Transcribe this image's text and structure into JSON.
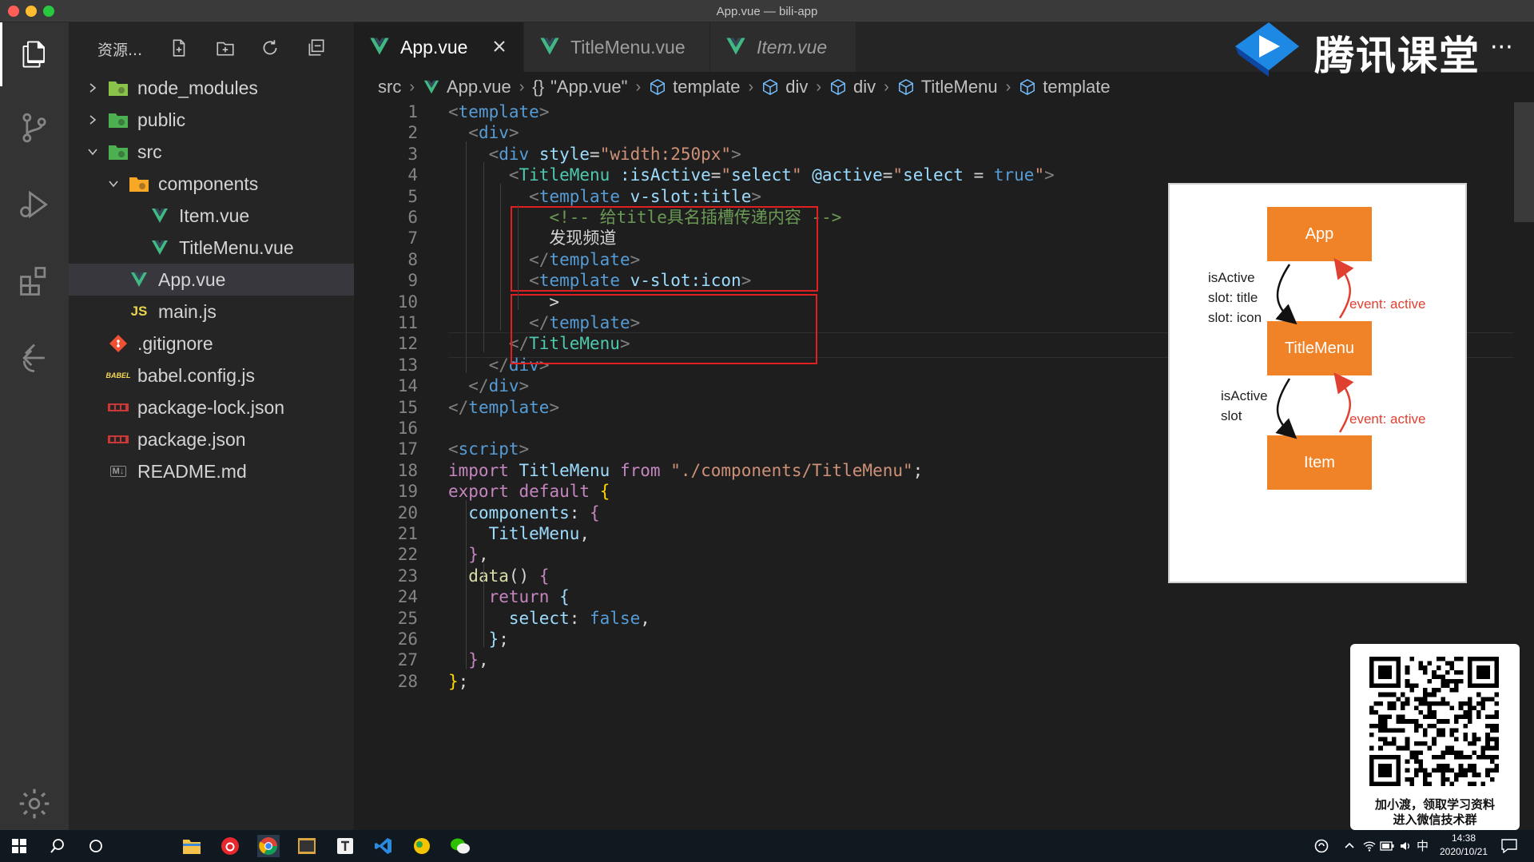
{
  "window": {
    "title": "App.vue — bili-app"
  },
  "sidebar": {
    "title": "资源...",
    "tree": [
      {
        "name": "node_modules",
        "kind": "folder",
        "expanded": false,
        "depth": 0,
        "icon": "folder-node-icon"
      },
      {
        "name": "public",
        "kind": "folder",
        "expanded": false,
        "depth": 0,
        "icon": "folder-public-icon"
      },
      {
        "name": "src",
        "kind": "folder",
        "expanded": true,
        "depth": 0,
        "icon": "folder-src-icon"
      },
      {
        "name": "components",
        "kind": "folder",
        "expanded": true,
        "depth": 1,
        "icon": "folder-components-icon"
      },
      {
        "name": "Item.vue",
        "kind": "vue",
        "depth": 2,
        "icon": "vue-file-icon"
      },
      {
        "name": "TitleMenu.vue",
        "kind": "vue",
        "depth": 2,
        "icon": "vue-file-icon"
      },
      {
        "name": "App.vue",
        "kind": "vue",
        "depth": 1,
        "icon": "vue-file-icon",
        "selected": true
      },
      {
        "name": "main.js",
        "kind": "js",
        "depth": 1,
        "icon": "js-file-icon"
      },
      {
        "name": ".gitignore",
        "kind": "git",
        "depth": 0,
        "icon": "git-file-icon"
      },
      {
        "name": "babel.config.js",
        "kind": "babel",
        "depth": 0,
        "icon": "babel-file-icon"
      },
      {
        "name": "package-lock.json",
        "kind": "npm",
        "depth": 0,
        "icon": "npm-file-icon"
      },
      {
        "name": "package.json",
        "kind": "npm",
        "depth": 0,
        "icon": "npm-file-icon"
      },
      {
        "name": "README.md",
        "kind": "md",
        "depth": 0,
        "icon": "markdown-file-icon"
      }
    ],
    "js_badge": "JS",
    "md_badge": "M↓",
    "babel_badge": "BABEL"
  },
  "tabs": [
    {
      "label": "App.vue",
      "active": true
    },
    {
      "label": "TitleMenu.vue",
      "active": false
    },
    {
      "label": "Item.vue",
      "active": false,
      "italic": true
    }
  ],
  "breadcrumb": [
    "src",
    "App.vue",
    "\"App.vue\"",
    "template",
    "div",
    "div",
    "TitleMenu",
    "template"
  ],
  "breadcrumb_braces": "{}",
  "editor": {
    "line_numbers": [
      "1",
      "2",
      "3",
      "4",
      "5",
      "6",
      "7",
      "8",
      "9",
      "10",
      "11",
      "12",
      "13",
      "14",
      "15",
      "16",
      "17",
      "18",
      "19",
      "20",
      "21",
      "22",
      "23",
      "24",
      "25",
      "26",
      "27",
      "28"
    ],
    "lines": [
      [
        [
          "tk-br",
          "<"
        ],
        [
          "tk-tag",
          "template"
        ],
        [
          "tk-br",
          ">"
        ]
      ],
      [
        [
          "tk-plain",
          "  "
        ],
        [
          "tk-br",
          "<"
        ],
        [
          "tk-tag",
          "div"
        ],
        [
          "tk-br",
          ">"
        ]
      ],
      [
        [
          "tk-plain",
          "    "
        ],
        [
          "tk-br",
          "<"
        ],
        [
          "tk-tag",
          "div"
        ],
        [
          "tk-plain",
          " "
        ],
        [
          "tk-attr",
          "style"
        ],
        [
          "tk-plain",
          "="
        ],
        [
          "tk-str",
          "\"width:250px\""
        ],
        [
          "tk-br",
          ">"
        ]
      ],
      [
        [
          "tk-plain",
          "      "
        ],
        [
          "tk-br",
          "<"
        ],
        [
          "tk-comp",
          "TitleMenu"
        ],
        [
          "tk-plain",
          " "
        ],
        [
          "tk-attr",
          ":isActive"
        ],
        [
          "tk-plain",
          "="
        ],
        [
          "tk-str",
          "\""
        ],
        [
          "tk-attr",
          "select"
        ],
        [
          "tk-str",
          "\""
        ],
        [
          "tk-plain",
          " "
        ],
        [
          "tk-attr",
          "@active"
        ],
        [
          "tk-plain",
          "="
        ],
        [
          "tk-str",
          "\""
        ],
        [
          "tk-attr",
          "select"
        ],
        [
          "tk-plain",
          " = "
        ],
        [
          "tk-bool",
          "true"
        ],
        [
          "tk-str",
          "\""
        ],
        [
          "tk-br",
          ">"
        ]
      ],
      [
        [
          "tk-plain",
          "        "
        ],
        [
          "tk-br",
          "<"
        ],
        [
          "tk-tag",
          "template"
        ],
        [
          "tk-plain",
          " "
        ],
        [
          "tk-attr",
          "v-slot:title"
        ],
        [
          "tk-br",
          ">"
        ]
      ],
      [
        [
          "tk-plain",
          "          "
        ],
        [
          "tk-com",
          "<!-- 给title具名插槽传递内容 -->"
        ]
      ],
      [
        [
          "tk-plain",
          "          发现频道"
        ]
      ],
      [
        [
          "tk-plain",
          "        "
        ],
        [
          "tk-br",
          "</"
        ],
        [
          "tk-tag",
          "template"
        ],
        [
          "tk-br",
          ">"
        ]
      ],
      [
        [
          "tk-plain",
          "        "
        ],
        [
          "tk-br",
          "<"
        ],
        [
          "tk-tag",
          "template"
        ],
        [
          "tk-plain",
          " "
        ],
        [
          "tk-attr",
          "v-slot:icon"
        ],
        [
          "tk-br",
          ">"
        ]
      ],
      [
        [
          "tk-plain",
          "          >"
        ]
      ],
      [
        [
          "tk-plain",
          "        "
        ],
        [
          "tk-br",
          "</"
        ],
        [
          "tk-tag",
          "template"
        ],
        [
          "tk-br",
          ">"
        ]
      ],
      [
        [
          "tk-plain",
          "      "
        ],
        [
          "tk-br",
          "</"
        ],
        [
          "tk-comp",
          "TitleMenu"
        ],
        [
          "tk-br",
          ">"
        ]
      ],
      [
        [
          "tk-plain",
          "    "
        ],
        [
          "tk-br",
          "</"
        ],
        [
          "tk-tag",
          "div"
        ],
        [
          "tk-br",
          ">"
        ]
      ],
      [
        [
          "tk-plain",
          "  "
        ],
        [
          "tk-br",
          "</"
        ],
        [
          "tk-tag",
          "div"
        ],
        [
          "tk-br",
          ">"
        ]
      ],
      [
        [
          "tk-br",
          "</"
        ],
        [
          "tk-tag",
          "template"
        ],
        [
          "tk-br",
          ">"
        ]
      ],
      [],
      [
        [
          "tk-br",
          "<"
        ],
        [
          "tk-tag",
          "script"
        ],
        [
          "tk-br",
          ">"
        ]
      ],
      [
        [
          "tk-kw",
          "import"
        ],
        [
          "tk-plain",
          " "
        ],
        [
          "tk-attr",
          "TitleMenu"
        ],
        [
          "tk-plain",
          " "
        ],
        [
          "tk-kw",
          "from"
        ],
        [
          "tk-plain",
          " "
        ],
        [
          "tk-str",
          "\"./components/TitleMenu\""
        ],
        [
          "tk-plain",
          ";"
        ]
      ],
      [
        [
          "tk-kw",
          "export"
        ],
        [
          "tk-plain",
          " "
        ],
        [
          "tk-kw",
          "default"
        ],
        [
          "tk-plain",
          " "
        ],
        [
          "tk-yel",
          "{"
        ]
      ],
      [
        [
          "tk-plain",
          "  "
        ],
        [
          "tk-attr",
          "components"
        ],
        [
          "tk-plain",
          ": "
        ],
        [
          "tk-kw",
          "{"
        ]
      ],
      [
        [
          "tk-plain",
          "    "
        ],
        [
          "tk-attr",
          "TitleMenu"
        ],
        [
          "tk-plain",
          ","
        ]
      ],
      [
        [
          "tk-plain",
          "  "
        ],
        [
          "tk-kw",
          "}"
        ],
        [
          "tk-plain",
          ","
        ]
      ],
      [
        [
          "tk-plain",
          "  "
        ],
        [
          "tk-fn",
          "data"
        ],
        [
          "tk-plain",
          "() "
        ],
        [
          "tk-kw",
          "{"
        ]
      ],
      [
        [
          "tk-plain",
          "    "
        ],
        [
          "tk-kw",
          "return"
        ],
        [
          "tk-plain",
          " "
        ],
        [
          "tk-attr",
          "{"
        ]
      ],
      [
        [
          "tk-plain",
          "      "
        ],
        [
          "tk-attr",
          "select"
        ],
        [
          "tk-plain",
          ": "
        ],
        [
          "tk-bool",
          "false"
        ],
        [
          "tk-plain",
          ","
        ]
      ],
      [
        [
          "tk-plain",
          "    "
        ],
        [
          "tk-attr",
          "}"
        ],
        [
          "tk-plain",
          ";"
        ]
      ],
      [
        [
          "tk-plain",
          "  "
        ],
        [
          "tk-kw",
          "}"
        ],
        [
          "tk-plain",
          ","
        ]
      ],
      [
        [
          "tk-yel",
          "}"
        ],
        [
          "tk-plain",
          ";"
        ]
      ]
    ]
  },
  "diagram": {
    "nodes": [
      "App",
      "TitleMenu",
      "Item"
    ],
    "down_labels_1": [
      "isActive",
      "slot: title",
      "slot: icon"
    ],
    "up_label_1": "event: active",
    "down_labels_2": [
      "isActive",
      "slot"
    ],
    "up_label_2": "event: active",
    "node_color": "#f08228",
    "event_color": "#e04030"
  },
  "logo": {
    "text": "腾讯课堂",
    "dots": "···"
  },
  "qr": {
    "lines": [
      "加小渡，领取学习资料",
      "进入微信技术群"
    ]
  },
  "taskbar": {
    "time": "14:38",
    "date": "2020/10/21",
    "ime": "中"
  },
  "colors": {
    "accent": "#007acc",
    "redbox": "#e02020",
    "vue": "#41b883"
  }
}
